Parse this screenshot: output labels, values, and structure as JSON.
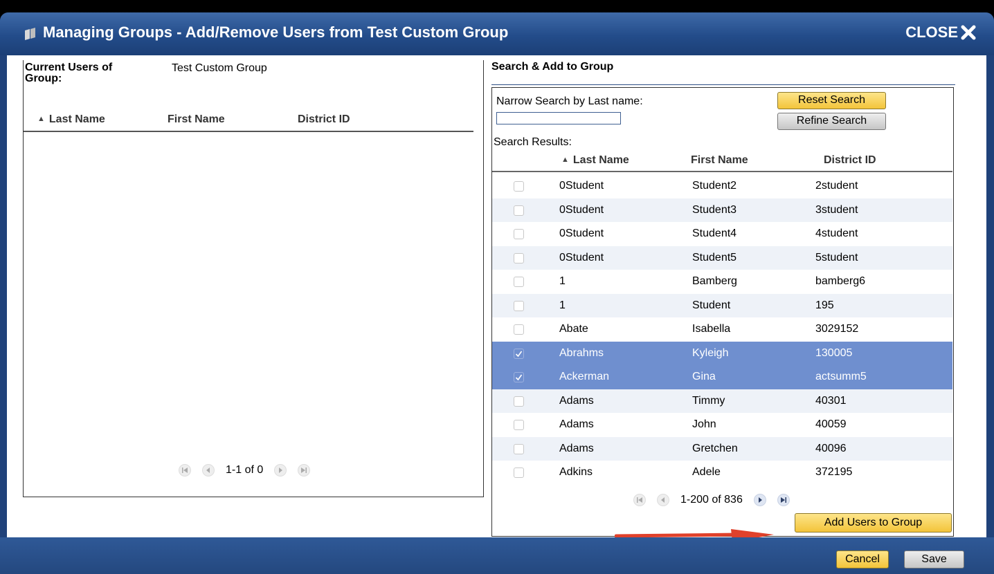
{
  "window": {
    "title": "Managing Groups - Add/Remove Users from Test Custom Group",
    "close_label": "CLOSE"
  },
  "left": {
    "current_users_label": "Current Users of Group:",
    "group_name": "Test Custom Group",
    "columns": {
      "last": "Last Name",
      "first": "First Name",
      "district": "District ID"
    },
    "pager_text": "1-1 of 0"
  },
  "right": {
    "section_title": "Search & Add to Group",
    "narrow_label": "Narrow Search by Last name:",
    "search_value": "",
    "reset_label": "Reset Search",
    "refine_label": "Refine Search",
    "results_label": "Search Results:",
    "columns": {
      "last": "Last Name",
      "first": "First Name",
      "district": "District ID"
    },
    "rows": [
      {
        "last": "0Student",
        "first": "Student2",
        "district": "2student",
        "checked": false
      },
      {
        "last": "0Student",
        "first": "Student3",
        "district": "3student",
        "checked": false
      },
      {
        "last": "0Student",
        "first": "Student4",
        "district": "4student",
        "checked": false
      },
      {
        "last": "0Student",
        "first": "Student5",
        "district": "5student",
        "checked": false
      },
      {
        "last": "1",
        "first": "Bamberg",
        "district": "bamberg6",
        "checked": false
      },
      {
        "last": "1",
        "first": "Student",
        "district": "195",
        "checked": false
      },
      {
        "last": "Abate",
        "first": "Isabella",
        "district": "3029152",
        "checked": false
      },
      {
        "last": "Abrahms",
        "first": "Kyleigh",
        "district": "130005",
        "checked": true
      },
      {
        "last": "Ackerman",
        "first": "Gina",
        "district": "actsumm5",
        "checked": true
      },
      {
        "last": "Adams",
        "first": "Timmy",
        "district": "40301",
        "checked": false
      },
      {
        "last": "Adams",
        "first": "John",
        "district": "40059",
        "checked": false
      },
      {
        "last": "Adams",
        "first": "Gretchen",
        "district": "40096",
        "checked": false
      },
      {
        "last": "Adkins",
        "first": "Adele",
        "district": "372195",
        "checked": false
      }
    ],
    "pager_text": "1-200 of 836",
    "add_label": "Add Users to Group"
  },
  "footer": {
    "cancel_label": "Cancel",
    "save_label": "Save"
  },
  "colors": {
    "titlebar": "#234c8a",
    "selected_row": "#6f8fcf",
    "button_yellow": "#f3c43a",
    "arrow_red": "#e0412b"
  }
}
